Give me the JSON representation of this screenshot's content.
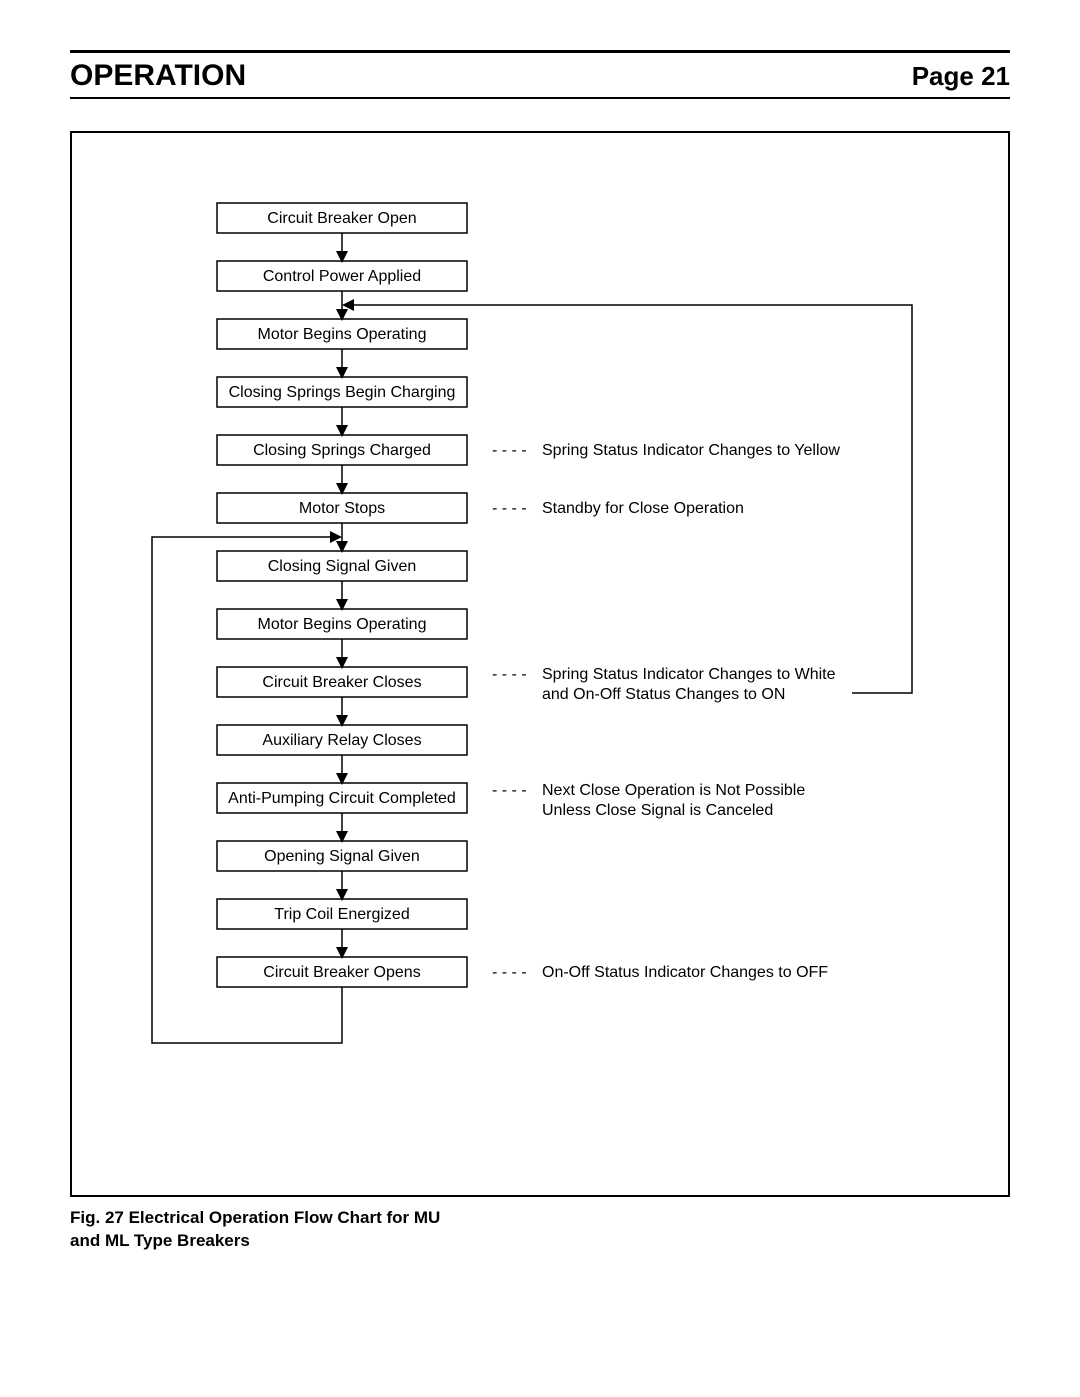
{
  "header": {
    "section_title": "OPERATION",
    "page_label": "Page 21"
  },
  "flowchart": {
    "steps": [
      {
        "id": "s1",
        "label": "Circuit Breaker Open"
      },
      {
        "id": "s2",
        "label": "Control Power Applied"
      },
      {
        "id": "s3",
        "label": "Motor Begins Operating"
      },
      {
        "id": "s4",
        "label": "Closing Springs Begin Charging"
      },
      {
        "id": "s5",
        "label": "Closing Springs Charged"
      },
      {
        "id": "s6",
        "label": "Motor Stops"
      },
      {
        "id": "s7",
        "label": "Closing Signal Given"
      },
      {
        "id": "s8",
        "label": "Motor Begins Operating"
      },
      {
        "id": "s9",
        "label": "Circuit Breaker Closes"
      },
      {
        "id": "s10",
        "label": "Auxiliary Relay Closes"
      },
      {
        "id": "s11",
        "label": "Anti-Pumping Circuit Completed"
      },
      {
        "id": "s12",
        "label": "Opening Signal Given"
      },
      {
        "id": "s13",
        "label": "Trip Coil Energized"
      },
      {
        "id": "s14",
        "label": "Circuit Breaker Opens"
      }
    ],
    "notes": {
      "n5": "Spring Status Indicator  Changes to Yellow",
      "n6": "Standby for Close Operation",
      "n9a": "Spring Status Indicator Changes to White",
      "n9b": "and On-Off Status Changes to ON",
      "n11a": "Next Close Operation is Not Possible",
      "n11b": "Unless Close Signal is Canceled",
      "n14": "On-Off Status Indicator Changes to OFF"
    },
    "dash_prefix": "- - - -"
  },
  "caption": {
    "line1": "Fig. 27  Electrical Operation Flow Chart for MU",
    "line2": "and ML Type Breakers"
  }
}
